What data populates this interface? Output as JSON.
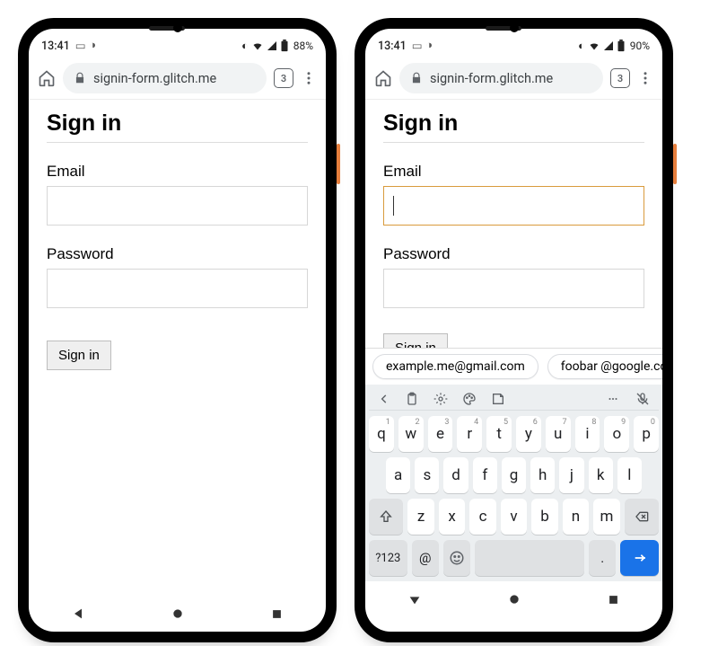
{
  "phones": [
    {
      "status": {
        "time": "13:41",
        "battery": "88%"
      },
      "url": "signin-form.glitch.me",
      "tab_count": "3",
      "page": {
        "heading": "Sign in",
        "email_label": "Email",
        "email_value": "",
        "email_focused": false,
        "password_label": "Password",
        "password_value": "",
        "submit_label": "Sign in"
      },
      "keyboard_visible": false
    },
    {
      "status": {
        "time": "13:41",
        "battery": "90%"
      },
      "url": "signin-form.glitch.me",
      "tab_count": "3",
      "page": {
        "heading": "Sign in",
        "email_label": "Email",
        "email_value": "",
        "email_focused": true,
        "password_label": "Password",
        "password_value": "",
        "submit_label": "Sign in"
      },
      "keyboard_visible": true,
      "suggestions": [
        "example.me@gmail.com",
        "foobar @google.co"
      ],
      "keyboard": {
        "row1": [
          {
            "main": "q",
            "hint": "1"
          },
          {
            "main": "w",
            "hint": "2"
          },
          {
            "main": "e",
            "hint": "3"
          },
          {
            "main": "r",
            "hint": "4"
          },
          {
            "main": "t",
            "hint": "5"
          },
          {
            "main": "y",
            "hint": "6"
          },
          {
            "main": "u",
            "hint": "7"
          },
          {
            "main": "i",
            "hint": "8"
          },
          {
            "main": "o",
            "hint": "9"
          },
          {
            "main": "p",
            "hint": "0"
          }
        ],
        "row2": [
          "a",
          "s",
          "d",
          "f",
          "g",
          "h",
          "j",
          "k",
          "l"
        ],
        "row3": [
          "z",
          "x",
          "c",
          "v",
          "b",
          "n",
          "m"
        ],
        "sym_label": "?123",
        "at_label": "@",
        "period_label": "."
      }
    }
  ]
}
